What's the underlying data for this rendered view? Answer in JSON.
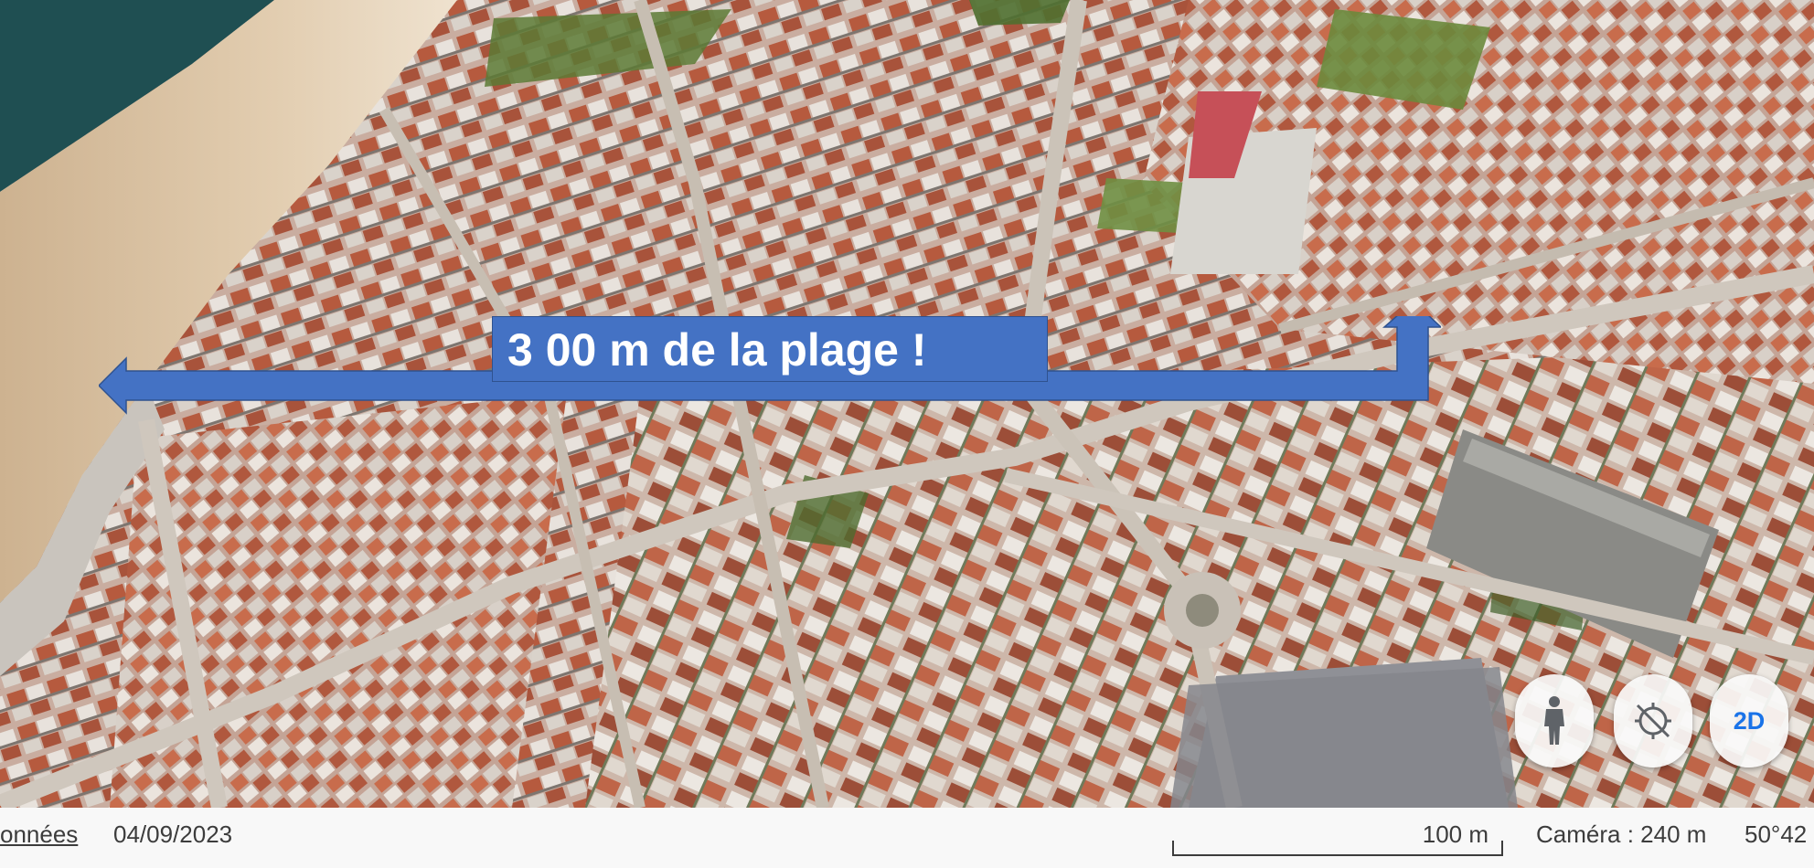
{
  "annotation": {
    "label": "3 00 m de la plage !"
  },
  "controls": {
    "street_view_icon": "person-icon",
    "compass_icon": "compass-icon",
    "view_toggle_label": "2D"
  },
  "status_bar": {
    "data_link": "onnées",
    "imagery_date": "04/09/2023",
    "scale_label": "100 m",
    "camera_altitude": "Caméra : 240 m",
    "coordinates": "50°42"
  },
  "colors": {
    "arrow_fill": "#4472c4",
    "arrow_border": "#2f528f",
    "sea": "#1f4f52",
    "sand": "#dcc3a3",
    "roof": "#b65a3e",
    "button_accent": "#1a73e8"
  }
}
